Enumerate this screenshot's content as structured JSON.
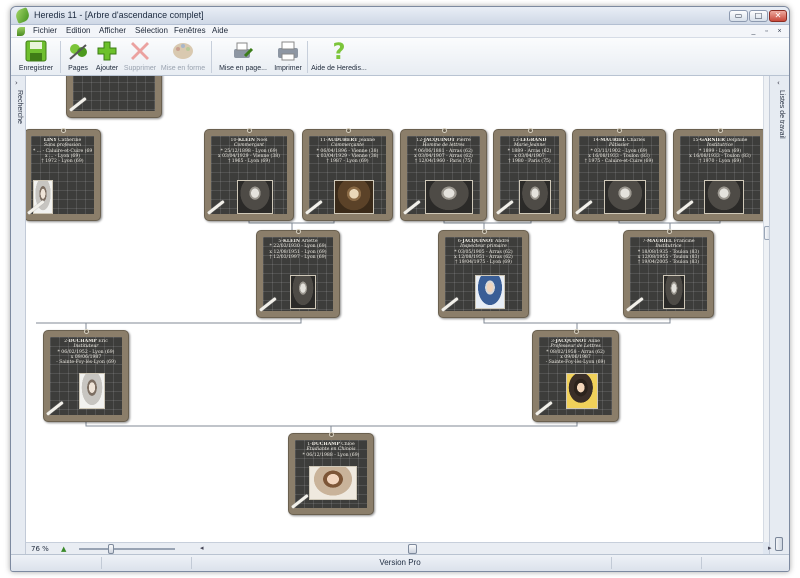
{
  "window": {
    "title": "Heredis 11 - [Arbre d'ascendance complet]",
    "controls": [
      "▭",
      "□",
      "✕"
    ]
  },
  "menu": {
    "items": [
      "Fichier",
      "Edition",
      "Afficher",
      "Sélection",
      "Fenêtres",
      "Aide"
    ],
    "mdi_controls": [
      "_",
      "▫",
      "×"
    ]
  },
  "toolbar": {
    "buttons": [
      {
        "label": "Enregistrer",
        "icon": "save-icon",
        "enabled": true
      },
      {
        "label": "Pages",
        "icon": "pages-icon",
        "enabled": true
      },
      {
        "label": "Ajouter",
        "icon": "add-icon",
        "enabled": true
      },
      {
        "label": "Supprimer",
        "icon": "delete-icon",
        "enabled": false
      },
      {
        "label": "Mise en forme",
        "icon": "palette-icon",
        "enabled": false
      },
      {
        "label": "Mise en page...",
        "icon": "page-setup-icon",
        "enabled": true
      },
      {
        "label": "Imprimer",
        "icon": "printer-icon",
        "enabled": true
      },
      {
        "label": "Aide de Heredis...",
        "icon": "help-icon",
        "enabled": true
      }
    ]
  },
  "left_panel": {
    "label": "Recherche",
    "arrow": "›"
  },
  "right_panel": {
    "label": "Listes de travail",
    "arrow": "‹"
  },
  "tree": {
    "persons": [
      {
        "id": "p0",
        "num": "",
        "surname": "",
        "given": "",
        "job": "",
        "events": []
      },
      {
        "id": "p1",
        "num": "",
        "surname": "LINY",
        "given": "Catherine",
        "job": "Sans profession",
        "events": [
          "* ... - Caluire-et-Cuire (69)",
          "x ... - Lyon (69)",
          "† 1972 - Lyon (69)"
        ],
        "photo": "ph-light"
      },
      {
        "id": "p10",
        "num": "10-",
        "surname": "KLEIN",
        "given": "Noël",
        "job": "Commerçant",
        "events": [
          "* 25/12/1898 - Lyon (69)",
          "x 03/04/1929 - Vienne (38)",
          "† 1965 - Lyon (69)"
        ],
        "photo": "ph-bw"
      },
      {
        "id": "p11",
        "num": "11-",
        "surname": "AUDUBERT",
        "given": "Jeanne",
        "job": "Commerçante",
        "events": [
          "* 06/04/1896 - Vienne (38)",
          "x 03/04/1929 - Vienne (38)",
          "† 1987 - Lyon (69)"
        ],
        "photo": "ph-sepia"
      },
      {
        "id": "p12",
        "num": "12-",
        "surname": "JACQUINOT",
        "given": "Pierre",
        "job": "Homme de lettres",
        "events": [
          "* 06/06/1881 - Arras (62)",
          "x 03/04/1907 - Arras (62)",
          "† 12/04/1960 - Paris (75)"
        ],
        "photo": "ph-bw"
      },
      {
        "id": "p13",
        "num": "13-",
        "surname": "LEGRAND",
        "given": "",
        "job": "Marie-Jeanne",
        "events": [
          "* 1889 - Arras (62)",
          "x 03/04/1907",
          "† 1980 - Paris (75)"
        ],
        "photo": "ph-bw"
      },
      {
        "id": "p14",
        "num": "14-",
        "surname": "MAURIEL",
        "given": "Charles",
        "job": "Pâtissier",
        "events": [
          "* 03/11/1902 - Lyon (69)",
          "x 16/08/1933 - Toulon (83)",
          "† 1975 - Caluire-et-Cuire (69)"
        ],
        "photo": "ph-bw"
      },
      {
        "id": "p15",
        "num": "15-",
        "surname": "GARNIER",
        "given": "Delphine",
        "job": "Institutrice",
        "events": [
          "* 1899 - Lyon (69)",
          "x 16/08/1933 - Toulon (83)",
          "† 1970 - Lyon (69)"
        ],
        "photo": "ph-bw"
      },
      {
        "id": "p5",
        "num": "5-",
        "surname": "KLEIN",
        "given": "Arlette",
        "job": "",
        "events": [
          "* 22/03/1930 - Lyon (69)",
          "x 12/08/1951 - Lyon (69)",
          "† 12/03/1997 - Lyon (69)"
        ],
        "photo": "ph-bw"
      },
      {
        "id": "p6",
        "num": "6-",
        "surname": "JACQUINOT",
        "given": "André",
        "job": "Inspecteur primaire",
        "events": [
          "* 03/05/1905 - Arras (62)",
          "x 12/08/1951 - Arras (62)",
          "† 19/04/1975 - Lyon (69)"
        ],
        "photo": "ph-blue"
      },
      {
        "id": "p7",
        "num": "7-",
        "surname": "MAURIEL",
        "given": "Francine",
        "job": "Institutrice",
        "events": [
          "* 18/08/1935 - Toulon (83)",
          "x 12/08/1955 - Toulon (83)",
          "† 19/04/2005 - Toulon (83)"
        ],
        "photo": "ph-bw"
      },
      {
        "id": "p2",
        "num": "2-",
        "surname": "DUCHAMP",
        "given": "Eric",
        "job": "Instituteur",
        "events": [
          "* 06/02/1952 - Lyon (69)",
          "x 09/06/1987",
          "- Sainte-Foy-lès-Lyon (69)"
        ],
        "photo": "ph-light"
      },
      {
        "id": "p3",
        "num": "3-",
        "surname": "JACQUINOT",
        "given": "Aline",
        "job": "Professeur de Lettres",
        "events": [
          "* 08/02/1958 - Arras (62)",
          "x 09/06/1987",
          "- Sainte-Foy-lès-Lyon (69)"
        ],
        "photo": "ph-yellow"
      },
      {
        "id": "p1root",
        "num": "1-",
        "surname": "DUCHAMP",
        "given": "Chloé",
        "job": "Étudiante en Chinois",
        "events": [
          "* 06/12/1988 - Lyon (69)"
        ],
        "photo": "ph-color"
      }
    ]
  },
  "zoom": {
    "label": "76 %",
    "up": "▲",
    "level": 0.3
  },
  "hscroll": {
    "left": "◂",
    "right": "▸",
    "position": 0.36
  },
  "status": {
    "text": "Version Pro"
  }
}
